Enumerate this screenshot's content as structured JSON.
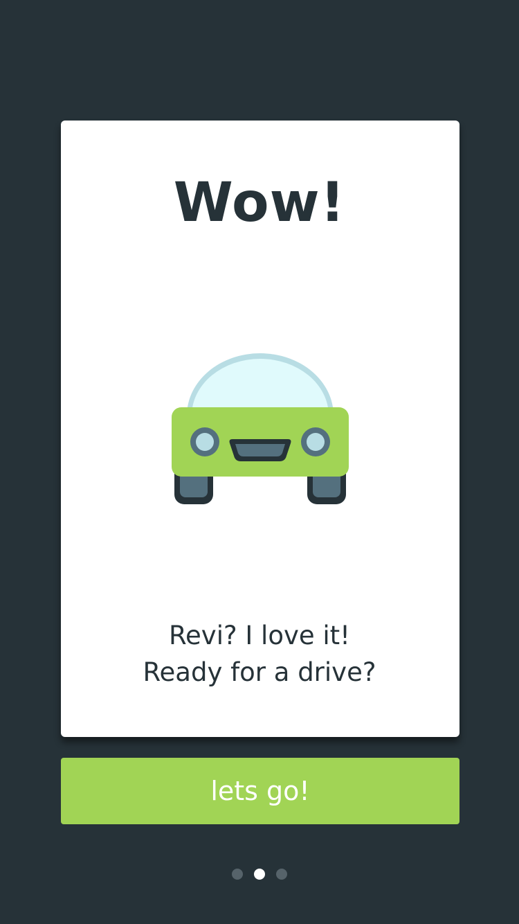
{
  "card": {
    "title": "Wow!",
    "illustration_icon": "car-front-icon",
    "message_line1": "Revi? I love it!",
    "message_line2": "Ready for a drive?"
  },
  "cta": {
    "label": "lets go!"
  },
  "pagination": {
    "current_page": 2,
    "total_pages": 3
  },
  "colors": {
    "background": "#263238",
    "card": "#ffffff",
    "accent": "#a1d455",
    "text": "#263238",
    "inactive_dot": "#56636a",
    "active_dot": "#ffffff"
  }
}
